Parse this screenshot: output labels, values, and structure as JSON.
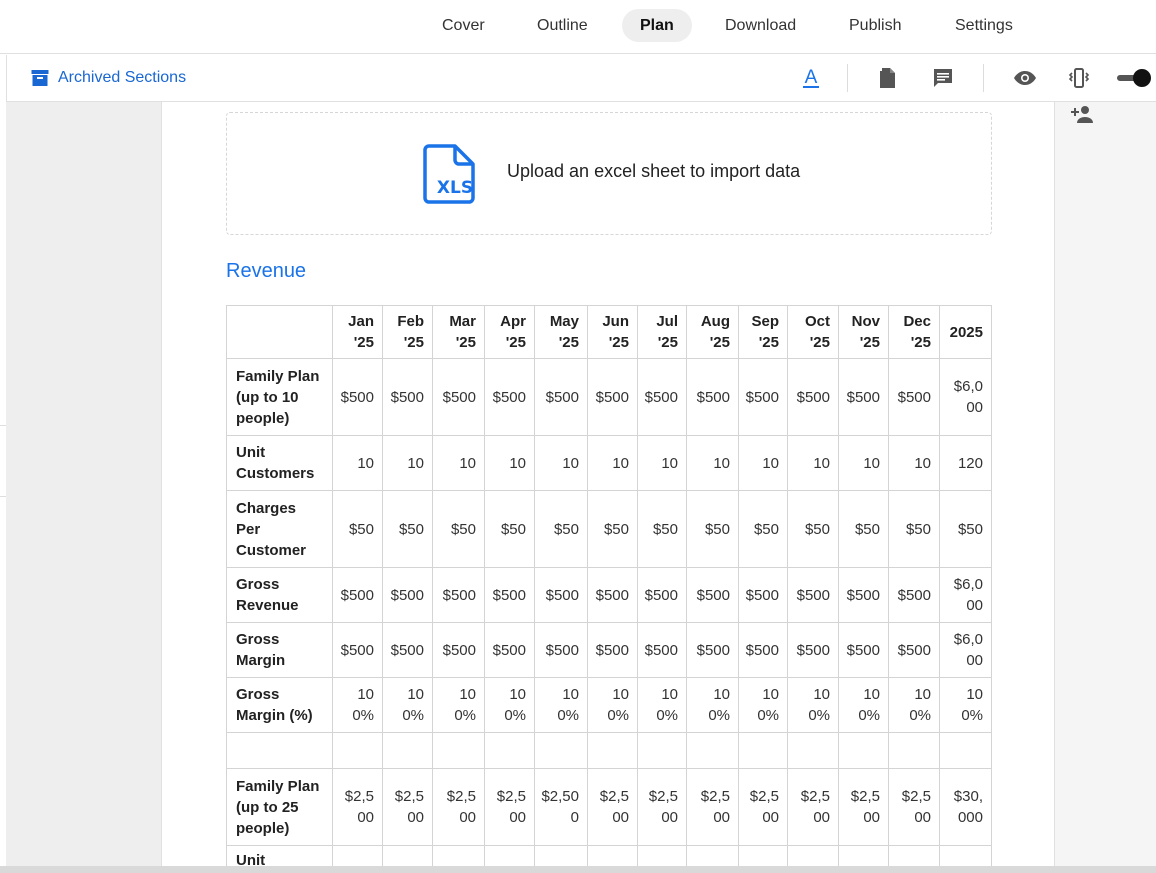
{
  "nav": {
    "tabs": [
      {
        "label": "Cover"
      },
      {
        "label": "Outline"
      },
      {
        "label": "Plan"
      },
      {
        "label": "Download"
      },
      {
        "label": "Publish"
      },
      {
        "label": "Settings"
      }
    ],
    "active": "Plan"
  },
  "toolbar": {
    "archived_label": "Archived Sections",
    "icons": [
      "text-format-icon",
      "document-icon",
      "comment-icon",
      "eye-icon",
      "vibrate-icon",
      "toggle-switch"
    ]
  },
  "upload": {
    "icon_text": "XLS",
    "label": "Upload an excel sheet to import data"
  },
  "section": {
    "title": "Revenue"
  },
  "table": {
    "headers": [
      "Jan '25",
      "Feb '25",
      "Mar '25",
      "Apr '25",
      "May '25",
      "Jun '25",
      "Jul '25",
      "Aug '25",
      "Sep '25",
      "Oct '25",
      "Nov '25",
      "Dec '25",
      "2025"
    ],
    "rows": [
      {
        "label": "Family Plan (up to 10 people)",
        "values": [
          "$500",
          "$500",
          "$500",
          "$500",
          "$500",
          "$500",
          "$500",
          "$500",
          "$500",
          "$500",
          "$500",
          "$500",
          "$6,000"
        ]
      },
      {
        "label": "Unit Customers",
        "values": [
          "10",
          "10",
          "10",
          "10",
          "10",
          "10",
          "10",
          "10",
          "10",
          "10",
          "10",
          "10",
          "120"
        ]
      },
      {
        "label": "Charges Per Customer",
        "values": [
          "$50",
          "$50",
          "$50",
          "$50",
          "$50",
          "$50",
          "$50",
          "$50",
          "$50",
          "$50",
          "$50",
          "$50",
          "$50"
        ]
      },
      {
        "label": "Gross Revenue",
        "values": [
          "$500",
          "$500",
          "$500",
          "$500",
          "$500",
          "$500",
          "$500",
          "$500",
          "$500",
          "$500",
          "$500",
          "$500",
          "$6,000"
        ]
      },
      {
        "label": "Gross Margin",
        "values": [
          "$500",
          "$500",
          "$500",
          "$500",
          "$500",
          "$500",
          "$500",
          "$500",
          "$500",
          "$500",
          "$500",
          "$500",
          "$6,000"
        ]
      },
      {
        "label": "Gross Margin (%)",
        "values": [
          "100%",
          "100%",
          "100%",
          "100%",
          "100%",
          "100%",
          "100%",
          "100%",
          "100%",
          "100%",
          "100%",
          "100%",
          "100%"
        ]
      },
      {
        "label": "",
        "values": [
          "",
          "",
          "",
          "",
          "",
          "",
          "",
          "",
          "",
          "",
          "",
          "",
          ""
        ]
      },
      {
        "label": "Family Plan (up to 25 people)",
        "values": [
          "$2,500",
          "$2,500",
          "$2,500",
          "$2,500",
          "$2,500",
          "$2,500",
          "$2,500",
          "$2,500",
          "$2,500",
          "$2,500",
          "$2,500",
          "$2,500",
          "$30,000"
        ]
      },
      {
        "label": "Unit",
        "values": [
          "",
          "",
          "",
          "",
          "",
          "",
          "",
          "",
          "",
          "",
          "",
          "",
          ""
        ]
      }
    ]
  },
  "colors": {
    "accent": "#1a73e8",
    "link": "#1967d2",
    "active_tab_bg": "#eeeeee",
    "workspace_bg": "#eeeeee"
  }
}
